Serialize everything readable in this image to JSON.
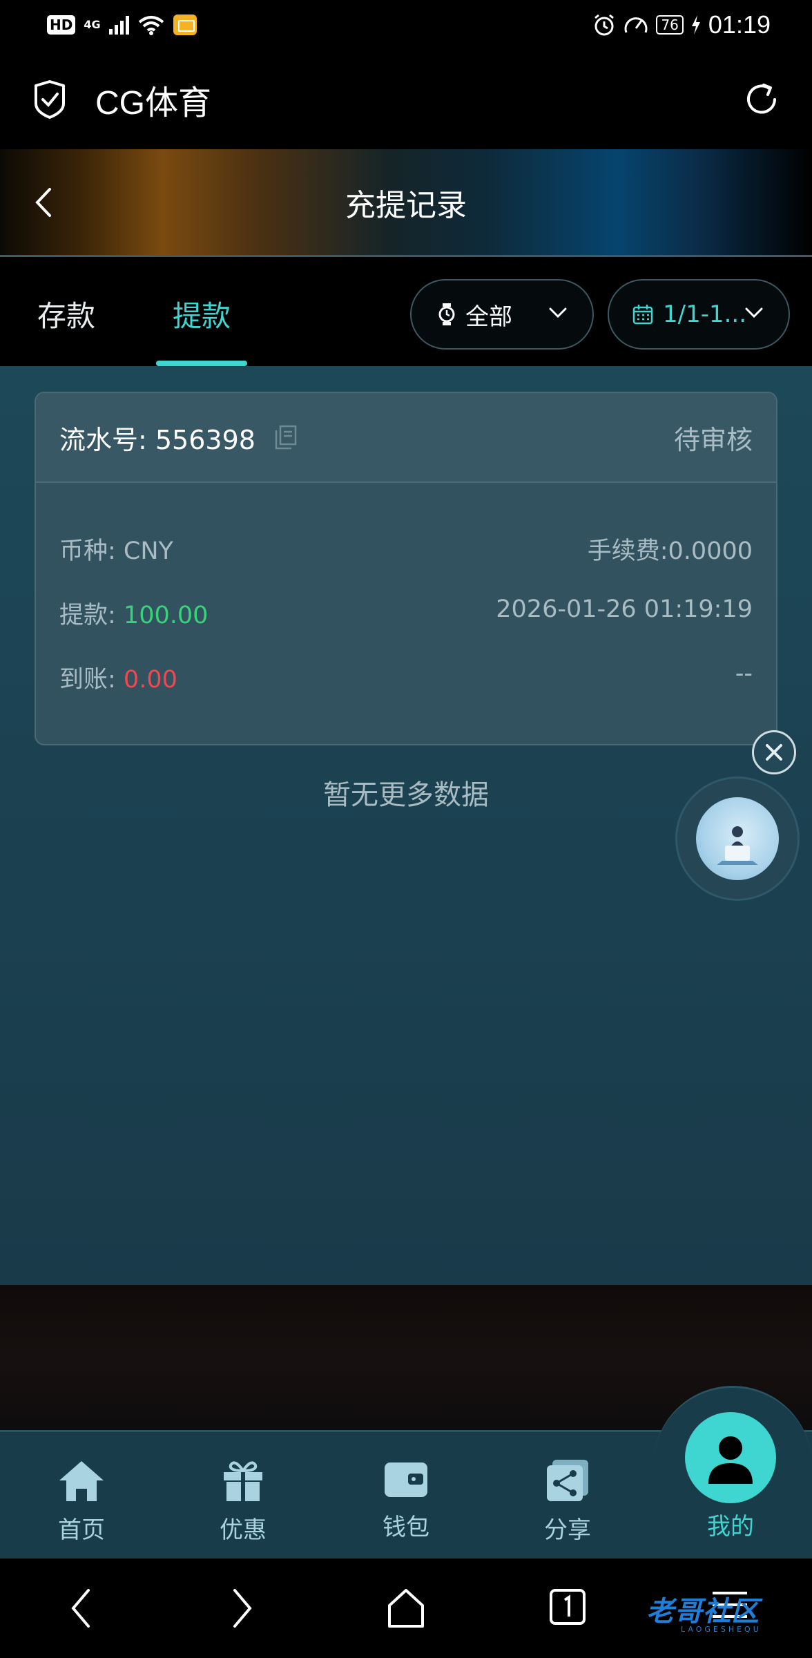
{
  "status_bar": {
    "hd": "HD",
    "network": "4G",
    "battery": "76",
    "time": "01:19"
  },
  "app": {
    "title": "CG体育"
  },
  "header": {
    "title": "充提记录"
  },
  "tabs": [
    {
      "label": "存款",
      "active": false
    },
    {
      "label": "提款",
      "active": true
    }
  ],
  "filters": {
    "status": "全部",
    "date": "1/1-1..."
  },
  "record": {
    "serial_label": "流水号: 556398",
    "status": "待审核",
    "currency_label": "币种: CNY",
    "fee_label": "手续费:0.0000",
    "withdraw_label": "提款: ",
    "withdraw_amount": "100.00",
    "datetime": "2026-01-26 01:19:19",
    "received_label": "到账: ",
    "received_amount": "0.00",
    "received_extra": "--"
  },
  "empty_text": "暂无更多数据",
  "bottom_nav": [
    {
      "label": "首页",
      "icon": "home-icon"
    },
    {
      "label": "优惠",
      "icon": "gift-icon"
    },
    {
      "label": "钱包",
      "icon": "wallet-icon"
    },
    {
      "label": "分享",
      "icon": "share-icon"
    },
    {
      "label": "我的",
      "icon": "user-icon",
      "active": true
    }
  ],
  "watermark": {
    "text": "老哥社区",
    "sub": "LAOGESHEQU"
  },
  "colors": {
    "accent": "#3fd5d0",
    "positive": "#38d27a",
    "negative": "#f0484e",
    "content_bg": "#1d4858",
    "card_bg": "#33525f"
  }
}
